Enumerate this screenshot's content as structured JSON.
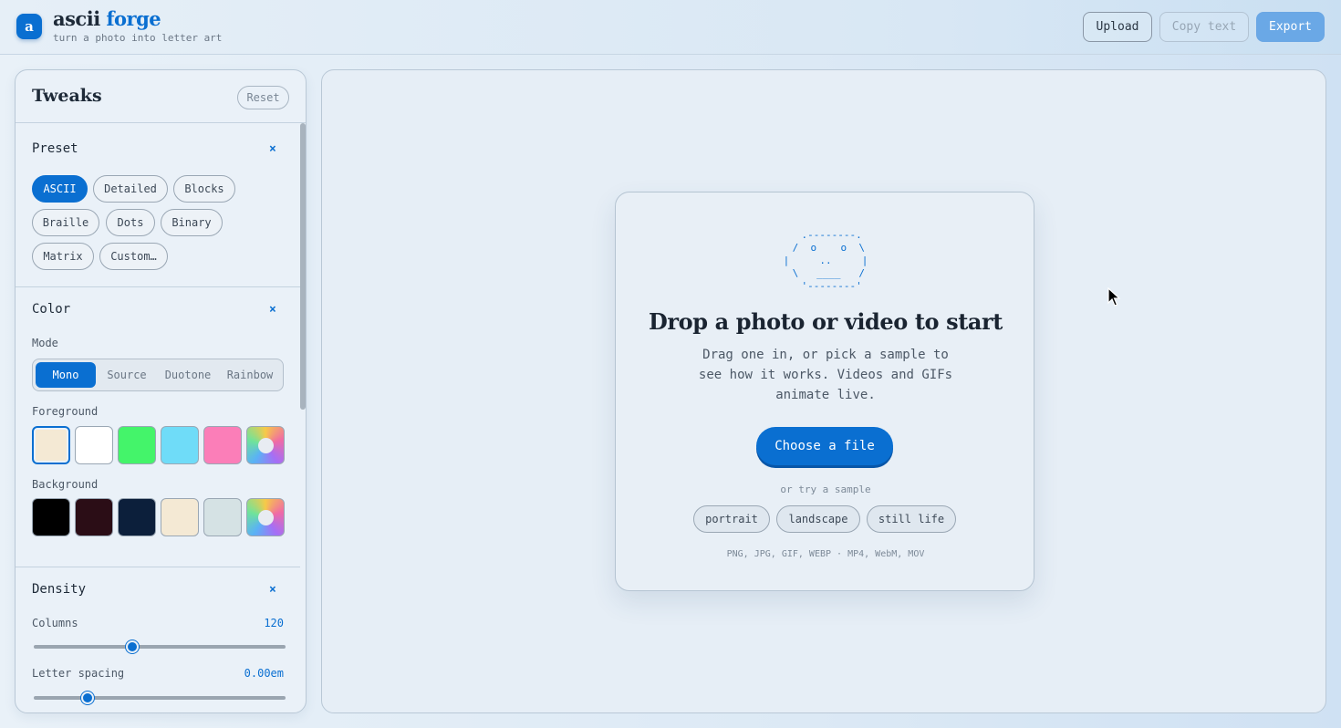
{
  "header": {
    "logo_letter": "a",
    "brand_part1": "ascii",
    "brand_part2": "forge",
    "tagline": "turn a photo into letter art",
    "buttons": {
      "upload": "Upload",
      "copy_text": "Copy text",
      "export": "Export"
    }
  },
  "sidebar": {
    "title": "Tweaks",
    "reset": "Reset",
    "preset": {
      "title": "Preset",
      "close": "×",
      "chips": [
        "ASCII",
        "Detailed",
        "Blocks",
        "Braille",
        "Dots",
        "Binary",
        "Matrix",
        "Custom…"
      ],
      "selected": "ASCII"
    },
    "color": {
      "title": "Color",
      "close": "×",
      "mode_label": "Mode",
      "modes": [
        "Mono",
        "Source",
        "Duotone",
        "Rainbow"
      ],
      "selected_mode": "Mono",
      "foreground_label": "Foreground",
      "foreground_colors": [
        "#f4e9d4",
        "#ffffff",
        "#44f46a",
        "#6fdcf8",
        "#fb7eb8",
        "rainbow"
      ],
      "selected_foreground": "#f4e9d4",
      "background_label": "Background",
      "background_colors": [
        "#000000",
        "#2b0d16",
        "#0c1f3b",
        "#f4e9d4",
        "#d5e2e4",
        "rainbow"
      ]
    },
    "density": {
      "title": "Density",
      "close": "×",
      "columns_label": "Columns",
      "columns_value": "120",
      "columns_fraction": 0.4,
      "spacing_label": "Letter spacing",
      "spacing_value": "0.00em",
      "spacing_fraction": 0.22
    }
  },
  "main": {
    "ascii_art": "  .--------.\n /  o    o  \\\n|     ..     |\n \\   ____   /\n  '--------'",
    "title": "Drop a photo or video to start",
    "subtitle": "Drag one in, or pick a sample to see how it works. Videos and GIFs animate live.",
    "choose_button": "Choose a file",
    "try_sample": "or try a sample",
    "samples": [
      "portrait",
      "landscape",
      "still life"
    ],
    "formats": "PNG, JPG, GIF, WEBP · MP4, WebM, MOV"
  },
  "colors": {
    "accent": "#0a6fd1",
    "export_button": "#6aa8e6"
  }
}
